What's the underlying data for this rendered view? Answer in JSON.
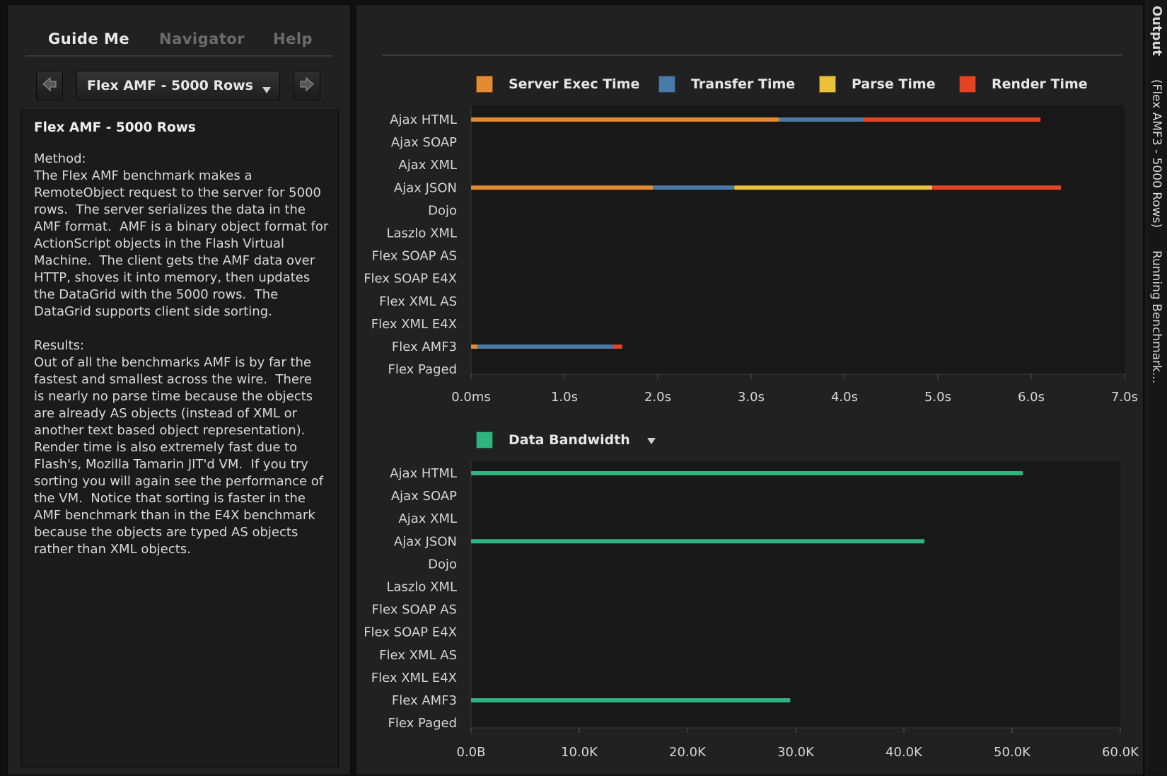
{
  "tabs": [
    {
      "label": "Guide Me",
      "active": true
    },
    {
      "label": "Navigator",
      "active": false
    },
    {
      "label": "Help",
      "active": false
    }
  ],
  "selector": {
    "value": "Flex AMF - 5000 Rows"
  },
  "description": {
    "title": "Flex AMF - 5000 Rows",
    "method_heading": "Method:",
    "method_text": "The Flex AMF benchmark makes a\nRemoteObject request to the server for 5000\nrows.  The server serializes the data in the\nAMF format.  AMF is a binary object format for\nActionScript objects in the Flash Virtual\nMachine.  The client gets the AMF data over\nHTTP, shoves it into memory, then updates\nthe DataGrid with the 5000 rows.  The\nDataGrid supports client side sorting.",
    "results_heading": "Results:",
    "results_text": "Out of all the benchmarks AMF is by far the\nfastest and smallest across the wire.  There\nis nearly no parse time because the objects\nare already AS objects (instead of XML or\nanother text based object representation).\nRender time is also extremely fast due to\nFlash's, Mozilla Tamarin JIT'd VM.  If you try\nsorting you will again see the performance of\nthe VM.  Notice that sorting is faster in the\nAMF benchmark than in the E4X benchmark\nbecause the objects are typed AS objects\nrather than XML objects."
  },
  "side_strip": {
    "output_label": "Output",
    "subtitle": "(Flex AMF3 - 5000 Rows)",
    "status": "Running Benchmark..."
  },
  "bandwidth_metric": "Data Bandwidth",
  "colors": {
    "server": "#e48a31",
    "transfer": "#4a7ba8",
    "parse": "#eac23a",
    "render": "#e54423",
    "bandwidth": "#2fb37f"
  },
  "chart_data": [
    {
      "type": "bar",
      "orientation": "horizontal",
      "stacked": true,
      "categories": [
        "Ajax HTML",
        "Ajax SOAP",
        "Ajax XML",
        "Ajax JSON",
        "Dojo",
        "Laszlo XML",
        "Flex SOAP AS",
        "Flex SOAP E4X",
        "Flex XML AS",
        "Flex XML E4X",
        "Flex AMF3",
        "Flex Paged"
      ],
      "series": [
        {
          "name": "Server Exec Time",
          "values": [
            3.3,
            0,
            0,
            1.95,
            0,
            0,
            0,
            0,
            0,
            0,
            0.07,
            0
          ]
        },
        {
          "name": "Transfer Time",
          "values": [
            0.9,
            0,
            0,
            0.87,
            0,
            0,
            0,
            0,
            0,
            0,
            1.45,
            0
          ]
        },
        {
          "name": "Parse Time",
          "values": [
            0,
            0,
            0,
            2.12,
            0,
            0,
            0,
            0,
            0,
            0,
            0,
            0
          ]
        },
        {
          "name": "Render Time",
          "values": [
            1.9,
            0,
            0,
            1.38,
            0,
            0,
            0,
            0,
            0,
            0,
            0.1,
            0
          ]
        }
      ],
      "xlim": [
        0,
        7
      ],
      "xticks": [
        "0.0ms",
        "1.0s",
        "2.0s",
        "3.0s",
        "4.0s",
        "5.0s",
        "6.0s",
        "7.0s"
      ],
      "legend": "top"
    },
    {
      "type": "bar",
      "orientation": "horizontal",
      "categories": [
        "Ajax HTML",
        "Ajax SOAP",
        "Ajax XML",
        "Ajax JSON",
        "Dojo",
        "Laszlo XML",
        "Flex SOAP AS",
        "Flex SOAP E4X",
        "Flex XML AS",
        "Flex XML E4X",
        "Flex AMF3",
        "Flex Paged"
      ],
      "series": [
        {
          "name": "Data Bandwidth",
          "values": [
            51000,
            0,
            0,
            41900,
            0,
            0,
            0,
            0,
            0,
            0,
            29500,
            0
          ]
        }
      ],
      "xlim": [
        0,
        60000
      ],
      "xticks": [
        "0.0B",
        "10.0K",
        "20.0K",
        "30.0K",
        "40.0K",
        "50.0K",
        "60.0K"
      ],
      "legend": "top"
    }
  ]
}
